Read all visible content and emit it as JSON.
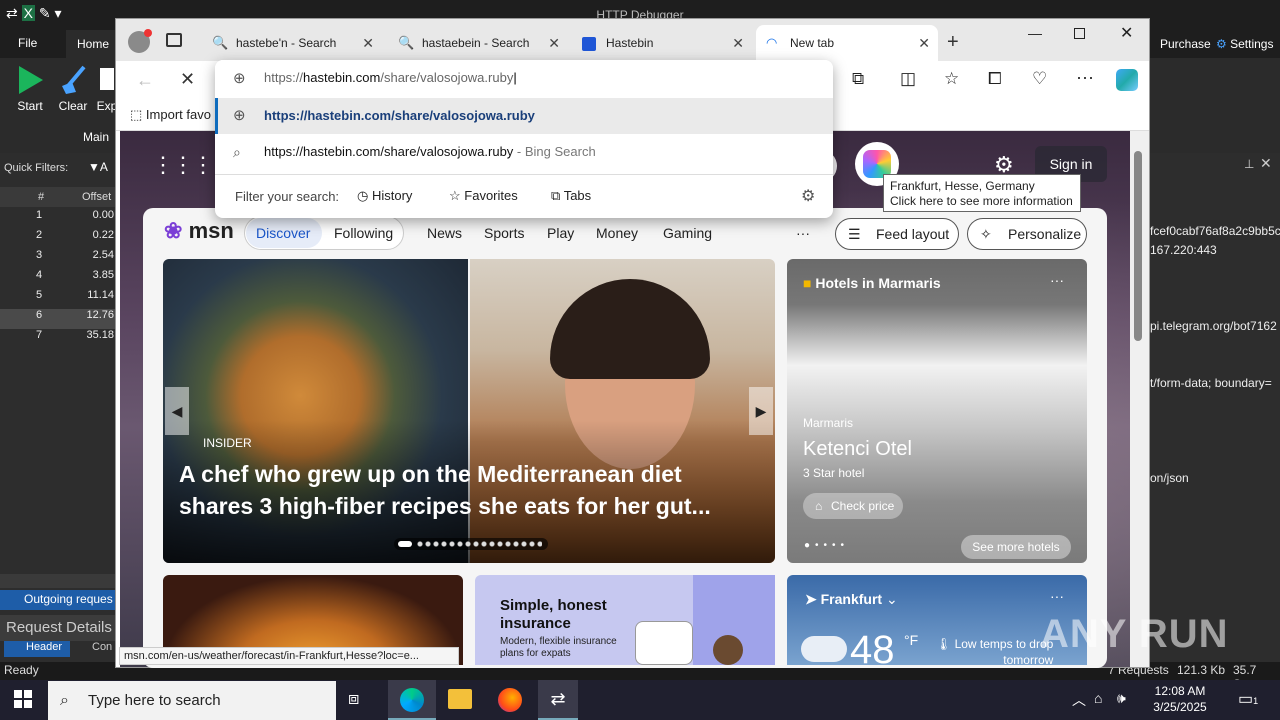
{
  "app": {
    "title": "HTTP Debugger",
    "tabs": {
      "file": "File",
      "home": "Home"
    },
    "ribbon": {
      "start": "Start",
      "clear": "Clear",
      "exp": "Exp",
      "group": "Main",
      "quick_filters": "Quick Filters:",
      "purchase": "Purchase",
      "settings": "Settings"
    },
    "table": {
      "headers": [
        "#",
        "Offset"
      ],
      "rows": [
        [
          "1",
          "0.00"
        ],
        [
          "2",
          "0.22"
        ],
        [
          "3",
          "2.54"
        ],
        [
          "4",
          "3.85"
        ],
        [
          "5",
          "11.14"
        ],
        [
          "6",
          "12.76"
        ],
        [
          "7",
          "35.18"
        ]
      ]
    },
    "outgoing": "Outgoing reques",
    "request_details": "Request Details",
    "bottom_tabs": {
      "header": "Header",
      "con": "Con"
    },
    "right_lines": [
      "fcef0cabf76af8a2c9bb5c0",
      "167.220:443",
      "pi.telegram.org/bot7162",
      "t/form-data; boundary=",
      "on/json"
    ],
    "status": {
      "ready": "Ready",
      "requests": "7 Requests",
      "size": "121.3 Kb",
      "time": "35.7 Sec"
    }
  },
  "browser": {
    "tabs": [
      {
        "label": "hastebe'n - Search"
      },
      {
        "label": "hastaebein - Search"
      },
      {
        "label": "Hastebin"
      },
      {
        "label": "New tab"
      }
    ],
    "address": "https://hastebin.com/share/valosojowa.ruby",
    "address_host": "hastebin.com",
    "address_path": "/share/valosojowa.ruby",
    "address_scheme": "https://",
    "import_favorites": "Import favo",
    "status_url": "msn.com/en-us/weather/forecast/in-Frankfurt,Hesse?loc=e..."
  },
  "omnibox": {
    "suggestion1": "https://hastebin.com/share/valosojowa.ruby",
    "suggestion2": "https://hastebin.com/share/valosojowa.ruby",
    "suggestion2_suffix": " - Bing Search",
    "filter_label": "Filter your search:",
    "history": "History",
    "favorites": "Favorites",
    "tabs": "Tabs"
  },
  "msn": {
    "sign_in": "Sign in",
    "tooltip_line1": "Frankfurt, Hesse, Germany",
    "tooltip_line2": "Click here to see more information",
    "logo": "msn",
    "nav": [
      "Discover",
      "Following",
      "News",
      "Sports",
      "Play",
      "Money",
      "Gaming"
    ],
    "more": "···",
    "feed_layout": "Feed layout",
    "personalize": "Personalize",
    "hero": {
      "source": "INSIDER",
      "headline1": "A chef who grew up on the Mediterranean diet",
      "headline2": "shares 3 high-fiber recipes she eats for her gut..."
    },
    "hotels": {
      "title": "Hotels in Marmaris",
      "city": "Marmaris",
      "name": "Ketenci Otel",
      "stars": "3 Star hotel",
      "check": "Check price",
      "more": "See more hotels"
    },
    "ins": {
      "title1": "Simple, honest",
      "title2": "insurance",
      "sub1": "Modern, flexible insurance",
      "sub2": "plans for expats"
    },
    "weather": {
      "city": "Frankfurt",
      "temp": "48",
      "unit": "°F",
      "note1": "Low temps to drop",
      "note2": "tomorrow"
    }
  },
  "taskbar": {
    "search": "Type here to search",
    "time": "12:08 AM",
    "date": "3/25/2025",
    "notif": "1"
  },
  "watermark": "ANY RUN"
}
